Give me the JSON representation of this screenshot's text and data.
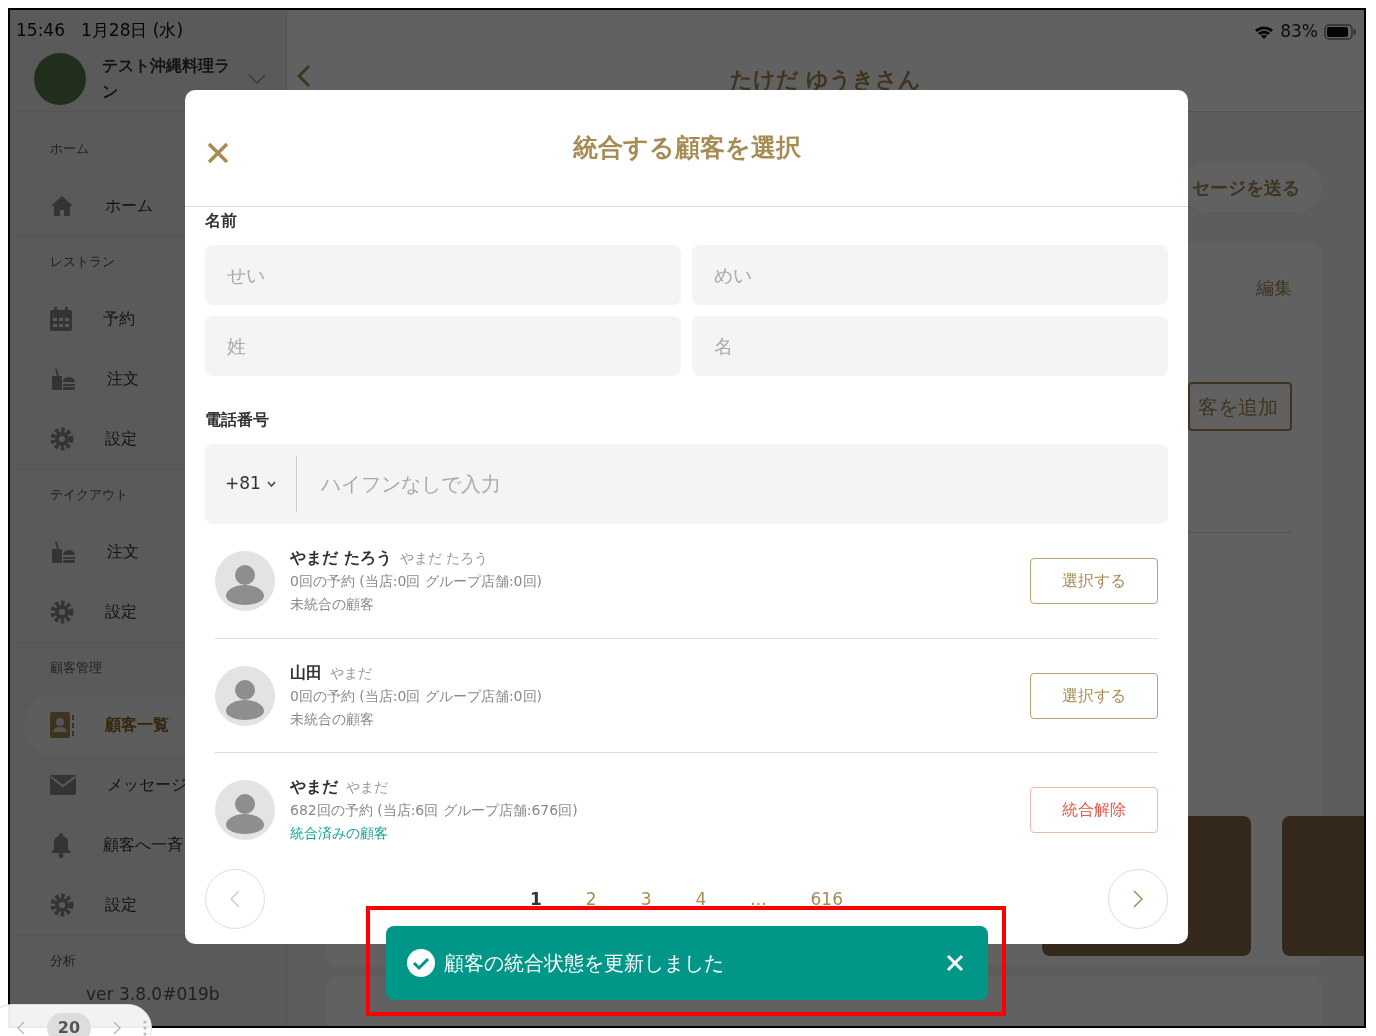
{
  "status_bar": {
    "time": "15:46",
    "date": "1月28日 (水)",
    "battery": "83%"
  },
  "sidebar": {
    "restaurant_name": "テスト沖縄料理ラン",
    "sections": [
      {
        "title": "ホーム",
        "items": [
          {
            "label": "ホーム",
            "kind": "home",
            "selected": false
          }
        ]
      },
      {
        "title": "レストラン",
        "items": [
          {
            "label": "予約",
            "kind": "calendar",
            "selected": false
          },
          {
            "label": "注文",
            "kind": "order",
            "selected": false
          },
          {
            "label": "設定",
            "kind": "gear",
            "selected": false
          }
        ]
      },
      {
        "title": "テイクアウト",
        "items": [
          {
            "label": "注文",
            "kind": "order",
            "selected": false
          },
          {
            "label": "設定",
            "kind": "gear",
            "selected": false
          }
        ]
      },
      {
        "title": "顧客管理",
        "items": [
          {
            "label": "顧客一覧",
            "kind": "contacts",
            "selected": true
          },
          {
            "label": "メッセージ",
            "kind": "mail",
            "selected": false
          },
          {
            "label": "顧客へ一斉",
            "kind": "bell",
            "selected": false
          },
          {
            "label": "設定",
            "kind": "gear",
            "selected": false
          }
        ]
      },
      {
        "title": "分析"
      }
    ],
    "version": "ver 3.8.0#019b"
  },
  "page": {
    "title": "たけだ ゆうきさん",
    "send_message_button": "セージを送る",
    "edit_link": "編集",
    "add_button": "客を追加"
  },
  "modal": {
    "title": "統合する顧客を選択",
    "name_label": "名前",
    "name_fields": [
      {
        "placeholder": "せい"
      },
      {
        "placeholder": "めい"
      },
      {
        "placeholder": "姓"
      },
      {
        "placeholder": "名"
      }
    ],
    "phone_label": "電話番号",
    "country_code": "+81",
    "phone_placeholder": "ハイフンなしで入力",
    "customers": [
      {
        "name": "やまだ たろう",
        "kana": "やまだ たろう",
        "reservations": "0回の予約 (当店:0回 グループ店舗:0回)",
        "status": "未統合の顧客",
        "kind": "unmerged",
        "action": "選択する"
      },
      {
        "name": "山田",
        "kana": "やまだ",
        "reservations": "0回の予約 (当店:0回 グループ店舗:0回)",
        "status": "未統合の顧客",
        "kind": "unmerged",
        "action": "選択する"
      },
      {
        "name": "やまだ",
        "kana": "やまだ",
        "reservations": "682回の予約 (当店:6回 グループ店舗:676回)",
        "status": "統合済みの顧客",
        "kind": "merged",
        "action": "統合解除"
      }
    ],
    "pagination": [
      {
        "label": "1",
        "selected": true
      },
      {
        "label": "2",
        "selected": false
      },
      {
        "label": "3",
        "selected": false
      },
      {
        "label": "4",
        "selected": false
      },
      {
        "label": "...",
        "selected": false
      },
      {
        "label": "616",
        "selected": false
      }
    ]
  },
  "toast": {
    "message": "顧客の統合状態を更新しました"
  },
  "browser_toolbar": {
    "tab_count": "20"
  }
}
